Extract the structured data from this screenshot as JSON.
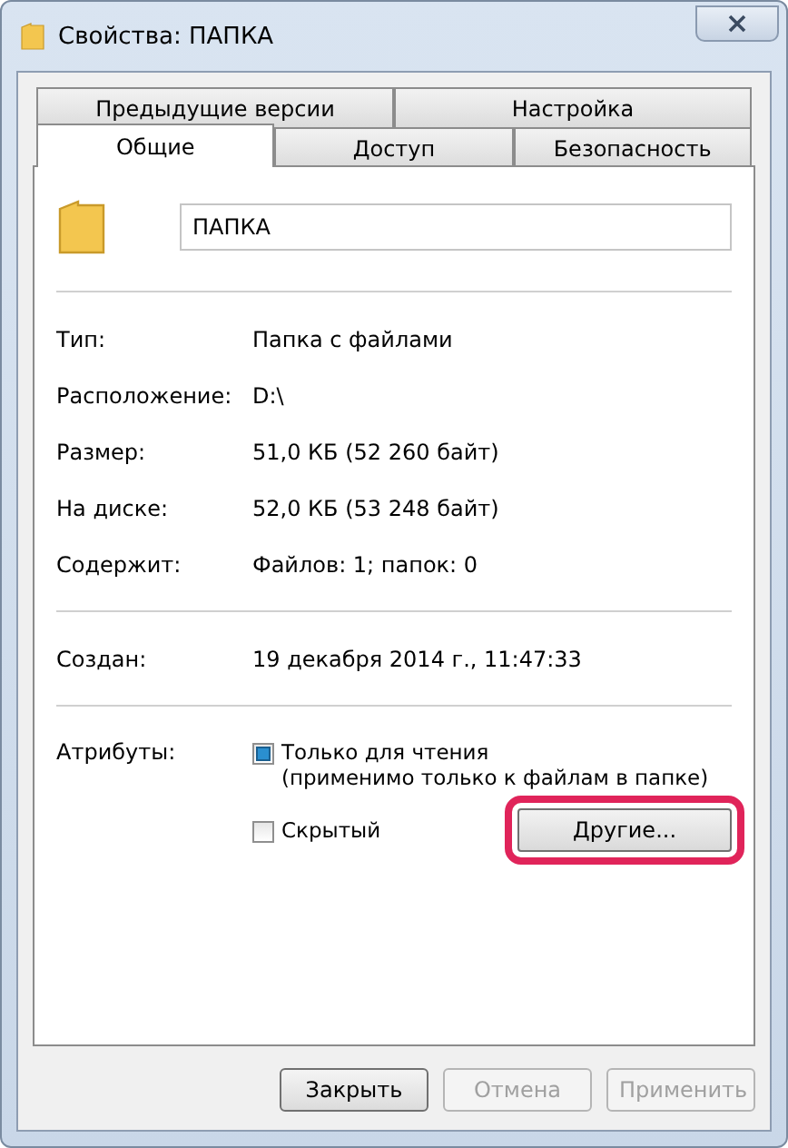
{
  "window": {
    "title": "Свойства: ПАПКА"
  },
  "tab_rows": [
    {
      "tabs": [
        {
          "label": "Предыдущие версии",
          "selected": false
        },
        {
          "label": "Настройка",
          "selected": false
        }
      ]
    },
    {
      "tabs": [
        {
          "label": "Общие",
          "selected": true
        },
        {
          "label": "Доступ",
          "selected": false
        },
        {
          "label": "Безопасность",
          "selected": false
        }
      ]
    }
  ],
  "name_field": {
    "value": "ПАПКА"
  },
  "groups": [
    {
      "rows": [
        {
          "label": "Тип:",
          "value": "Папка с файлами"
        },
        {
          "label": "Расположение:",
          "value": "D:\\"
        },
        {
          "label": "Размер:",
          "value": "51,0 КБ (52 260 байт)"
        },
        {
          "label": "На диске:",
          "value": "52,0 КБ (53 248 байт)"
        },
        {
          "label": "Содержит:",
          "value": "Файлов: 1; папок: 0"
        }
      ]
    },
    {
      "rows": [
        {
          "label": "Создан:",
          "value": "19 декабря 2014 г., 11:47:33"
        }
      ]
    }
  ],
  "attributes": {
    "label": "Атрибуты:",
    "items": [
      {
        "label": "Только для чтения",
        "note": "(применимо только к файлам в папке)",
        "checked": false,
        "indeterminate": true
      },
      {
        "label": "Скрытый",
        "checked": false,
        "indeterminate": false
      }
    ],
    "advanced_button": {
      "label": "Другие...",
      "highlighted": true
    }
  },
  "buttons": [
    {
      "label": "Закрыть",
      "disabled": false
    },
    {
      "label": "Отмена",
      "disabled": true
    },
    {
      "label": "Применить",
      "disabled": true
    }
  ]
}
